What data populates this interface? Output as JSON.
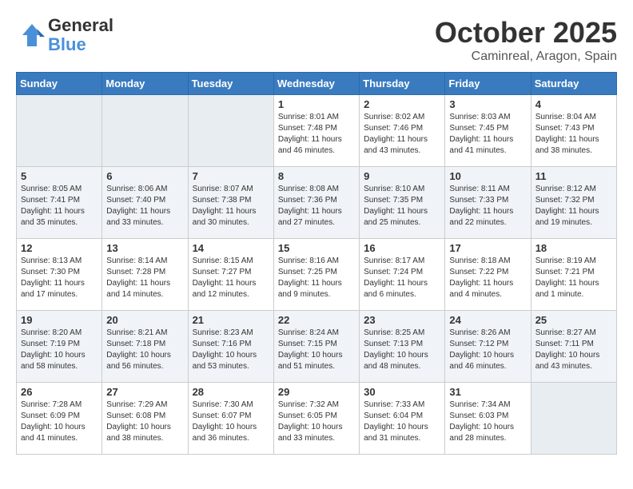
{
  "logo": {
    "text_general": "General",
    "text_blue": "Blue"
  },
  "title": "October 2025",
  "location": "Caminreal, Aragon, Spain",
  "days_of_week": [
    "Sunday",
    "Monday",
    "Tuesday",
    "Wednesday",
    "Thursday",
    "Friday",
    "Saturday"
  ],
  "weeks": [
    [
      {
        "day": "",
        "sunrise": "",
        "sunset": "",
        "daylight": "",
        "empty": true
      },
      {
        "day": "",
        "sunrise": "",
        "sunset": "",
        "daylight": "",
        "empty": true
      },
      {
        "day": "",
        "sunrise": "",
        "sunset": "",
        "daylight": "",
        "empty": true
      },
      {
        "day": "1",
        "sunrise": "Sunrise: 8:01 AM",
        "sunset": "Sunset: 7:48 PM",
        "daylight": "Daylight: 11 hours and 46 minutes."
      },
      {
        "day": "2",
        "sunrise": "Sunrise: 8:02 AM",
        "sunset": "Sunset: 7:46 PM",
        "daylight": "Daylight: 11 hours and 43 minutes."
      },
      {
        "day": "3",
        "sunrise": "Sunrise: 8:03 AM",
        "sunset": "Sunset: 7:45 PM",
        "daylight": "Daylight: 11 hours and 41 minutes."
      },
      {
        "day": "4",
        "sunrise": "Sunrise: 8:04 AM",
        "sunset": "Sunset: 7:43 PM",
        "daylight": "Daylight: 11 hours and 38 minutes."
      }
    ],
    [
      {
        "day": "5",
        "sunrise": "Sunrise: 8:05 AM",
        "sunset": "Sunset: 7:41 PM",
        "daylight": "Daylight: 11 hours and 35 minutes."
      },
      {
        "day": "6",
        "sunrise": "Sunrise: 8:06 AM",
        "sunset": "Sunset: 7:40 PM",
        "daylight": "Daylight: 11 hours and 33 minutes."
      },
      {
        "day": "7",
        "sunrise": "Sunrise: 8:07 AM",
        "sunset": "Sunset: 7:38 PM",
        "daylight": "Daylight: 11 hours and 30 minutes."
      },
      {
        "day": "8",
        "sunrise": "Sunrise: 8:08 AM",
        "sunset": "Sunset: 7:36 PM",
        "daylight": "Daylight: 11 hours and 27 minutes."
      },
      {
        "day": "9",
        "sunrise": "Sunrise: 8:10 AM",
        "sunset": "Sunset: 7:35 PM",
        "daylight": "Daylight: 11 hours and 25 minutes."
      },
      {
        "day": "10",
        "sunrise": "Sunrise: 8:11 AM",
        "sunset": "Sunset: 7:33 PM",
        "daylight": "Daylight: 11 hours and 22 minutes."
      },
      {
        "day": "11",
        "sunrise": "Sunrise: 8:12 AM",
        "sunset": "Sunset: 7:32 PM",
        "daylight": "Daylight: 11 hours and 19 minutes."
      }
    ],
    [
      {
        "day": "12",
        "sunrise": "Sunrise: 8:13 AM",
        "sunset": "Sunset: 7:30 PM",
        "daylight": "Daylight: 11 hours and 17 minutes."
      },
      {
        "day": "13",
        "sunrise": "Sunrise: 8:14 AM",
        "sunset": "Sunset: 7:28 PM",
        "daylight": "Daylight: 11 hours and 14 minutes."
      },
      {
        "day": "14",
        "sunrise": "Sunrise: 8:15 AM",
        "sunset": "Sunset: 7:27 PM",
        "daylight": "Daylight: 11 hours and 12 minutes."
      },
      {
        "day": "15",
        "sunrise": "Sunrise: 8:16 AM",
        "sunset": "Sunset: 7:25 PM",
        "daylight": "Daylight: 11 hours and 9 minutes."
      },
      {
        "day": "16",
        "sunrise": "Sunrise: 8:17 AM",
        "sunset": "Sunset: 7:24 PM",
        "daylight": "Daylight: 11 hours and 6 minutes."
      },
      {
        "day": "17",
        "sunrise": "Sunrise: 8:18 AM",
        "sunset": "Sunset: 7:22 PM",
        "daylight": "Daylight: 11 hours and 4 minutes."
      },
      {
        "day": "18",
        "sunrise": "Sunrise: 8:19 AM",
        "sunset": "Sunset: 7:21 PM",
        "daylight": "Daylight: 11 hours and 1 minute."
      }
    ],
    [
      {
        "day": "19",
        "sunrise": "Sunrise: 8:20 AM",
        "sunset": "Sunset: 7:19 PM",
        "daylight": "Daylight: 10 hours and 58 minutes."
      },
      {
        "day": "20",
        "sunrise": "Sunrise: 8:21 AM",
        "sunset": "Sunset: 7:18 PM",
        "daylight": "Daylight: 10 hours and 56 minutes."
      },
      {
        "day": "21",
        "sunrise": "Sunrise: 8:23 AM",
        "sunset": "Sunset: 7:16 PM",
        "daylight": "Daylight: 10 hours and 53 minutes."
      },
      {
        "day": "22",
        "sunrise": "Sunrise: 8:24 AM",
        "sunset": "Sunset: 7:15 PM",
        "daylight": "Daylight: 10 hours and 51 minutes."
      },
      {
        "day": "23",
        "sunrise": "Sunrise: 8:25 AM",
        "sunset": "Sunset: 7:13 PM",
        "daylight": "Daylight: 10 hours and 48 minutes."
      },
      {
        "day": "24",
        "sunrise": "Sunrise: 8:26 AM",
        "sunset": "Sunset: 7:12 PM",
        "daylight": "Daylight: 10 hours and 46 minutes."
      },
      {
        "day": "25",
        "sunrise": "Sunrise: 8:27 AM",
        "sunset": "Sunset: 7:11 PM",
        "daylight": "Daylight: 10 hours and 43 minutes."
      }
    ],
    [
      {
        "day": "26",
        "sunrise": "Sunrise: 7:28 AM",
        "sunset": "Sunset: 6:09 PM",
        "daylight": "Daylight: 10 hours and 41 minutes."
      },
      {
        "day": "27",
        "sunrise": "Sunrise: 7:29 AM",
        "sunset": "Sunset: 6:08 PM",
        "daylight": "Daylight: 10 hours and 38 minutes."
      },
      {
        "day": "28",
        "sunrise": "Sunrise: 7:30 AM",
        "sunset": "Sunset: 6:07 PM",
        "daylight": "Daylight: 10 hours and 36 minutes."
      },
      {
        "day": "29",
        "sunrise": "Sunrise: 7:32 AM",
        "sunset": "Sunset: 6:05 PM",
        "daylight": "Daylight: 10 hours and 33 minutes."
      },
      {
        "day": "30",
        "sunrise": "Sunrise: 7:33 AM",
        "sunset": "Sunset: 6:04 PM",
        "daylight": "Daylight: 10 hours and 31 minutes."
      },
      {
        "day": "31",
        "sunrise": "Sunrise: 7:34 AM",
        "sunset": "Sunset: 6:03 PM",
        "daylight": "Daylight: 10 hours and 28 minutes."
      },
      {
        "day": "",
        "sunrise": "",
        "sunset": "",
        "daylight": "",
        "empty": true
      }
    ]
  ]
}
